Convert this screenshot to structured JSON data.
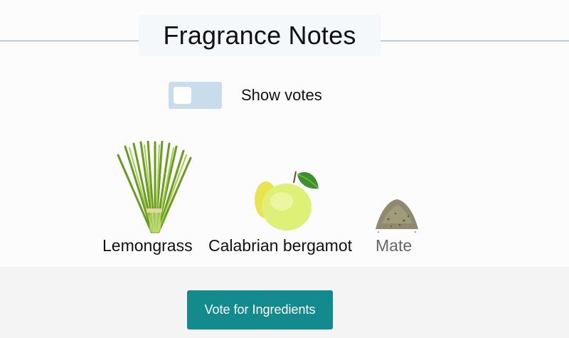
{
  "section": {
    "title": "Fragrance Notes"
  },
  "votes_toggle": {
    "label": "Show votes",
    "checked": false
  },
  "notes": [
    {
      "name": "Lemongrass",
      "icon": "lemongrass-image"
    },
    {
      "name": "Calabrian bergamot",
      "icon": "bergamot-image"
    },
    {
      "name": "Mate",
      "icon": "mate-image",
      "label_color": "#666666"
    }
  ],
  "actions": {
    "vote_label": "Vote for Ingredients"
  },
  "colors": {
    "accent": "#138a8c",
    "toggle_track": "#c9dcec",
    "rule": "#7aa7b8"
  }
}
